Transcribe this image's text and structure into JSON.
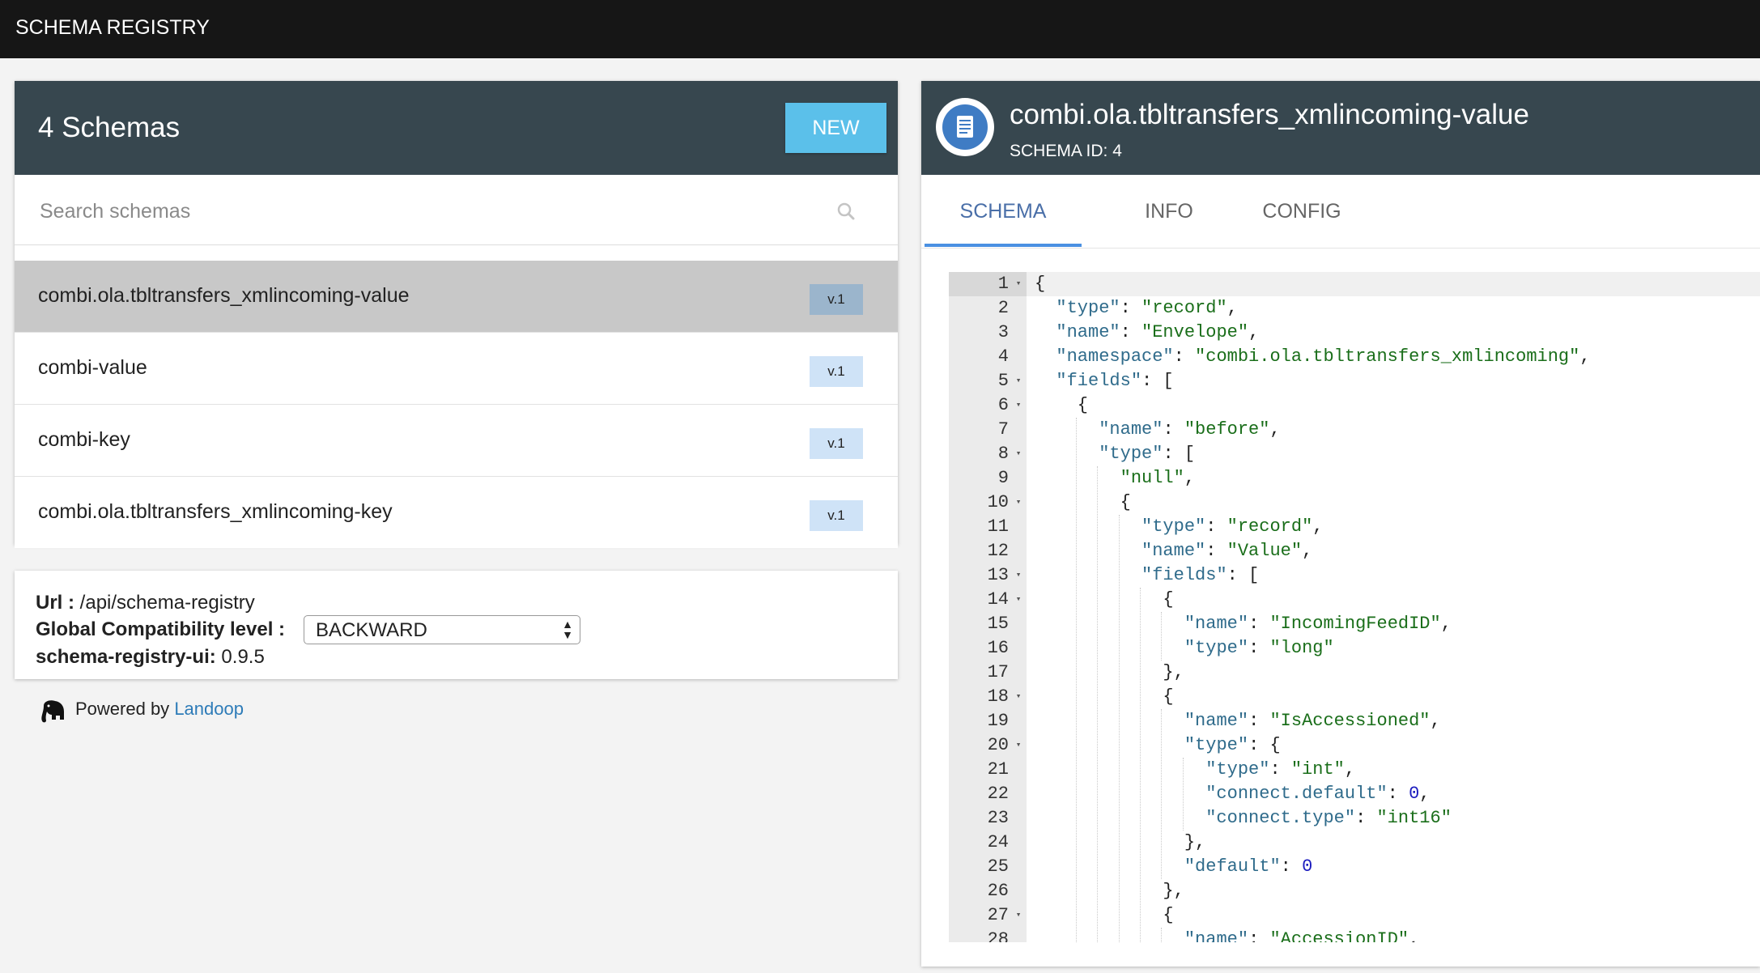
{
  "app": {
    "title": "SCHEMA REGISTRY"
  },
  "schemas_panel": {
    "count_label": "4 Schemas",
    "new_button": "NEW",
    "search_placeholder": "Search schemas",
    "items": [
      {
        "name": "combi.ola.tbltransfers_xmlincoming-value",
        "version": "v.1",
        "selected": true
      },
      {
        "name": "combi-value",
        "version": "v.1",
        "selected": false
      },
      {
        "name": "combi-key",
        "version": "v.1",
        "selected": false
      },
      {
        "name": "combi.ola.tbltransfers_xmlincoming-key",
        "version": "v.1",
        "selected": false
      }
    ]
  },
  "info": {
    "url_label": "Url :",
    "url_value": "/api/schema-registry",
    "compat_label": "Global Compatibility level :",
    "compat_value": "BACKWARD",
    "ui_label": "schema-registry-ui:",
    "ui_value": "0.9.5"
  },
  "footer": {
    "powered_by": "Powered by",
    "link": "Landoop"
  },
  "detail": {
    "title": "combi.ola.tbltransfers_xmlincoming-value",
    "schema_id": "SCHEMA ID: 4",
    "tabs": [
      "SCHEMA",
      "INFO",
      "CONFIG"
    ],
    "active_tab": "SCHEMA"
  },
  "editor_lines": [
    "{",
    "  \"type\": \"record\",",
    "  \"name\": \"Envelope\",",
    "  \"namespace\": \"combi.ola.tbltransfers_xmlincoming\",",
    "  \"fields\": [",
    "    {",
    "      \"name\": \"before\",",
    "      \"type\": [",
    "        \"null\",",
    "        {",
    "          \"type\": \"record\",",
    "          \"name\": \"Value\",",
    "          \"fields\": [",
    "            {",
    "              \"name\": \"IncomingFeedID\",",
    "              \"type\": \"long\"",
    "            },",
    "            {",
    "              \"name\": \"IsAccessioned\",",
    "              \"type\": {",
    "                \"type\": \"int\",",
    "                \"connect.default\": 0,",
    "                \"connect.type\": \"int16\"",
    "              },",
    "              \"default\": 0",
    "            },",
    "            {",
    "              \"name\": \"AccessionID\","
  ],
  "fold_lines": [
    1,
    5,
    6,
    8,
    10,
    13,
    14,
    18,
    20,
    27
  ],
  "colors": {
    "topbar": "#161616",
    "header": "#37474f",
    "accent": "#5bc0ea",
    "key": "#2f6b8b",
    "string": "#1a6e1a",
    "number": "#1d1dbf"
  }
}
